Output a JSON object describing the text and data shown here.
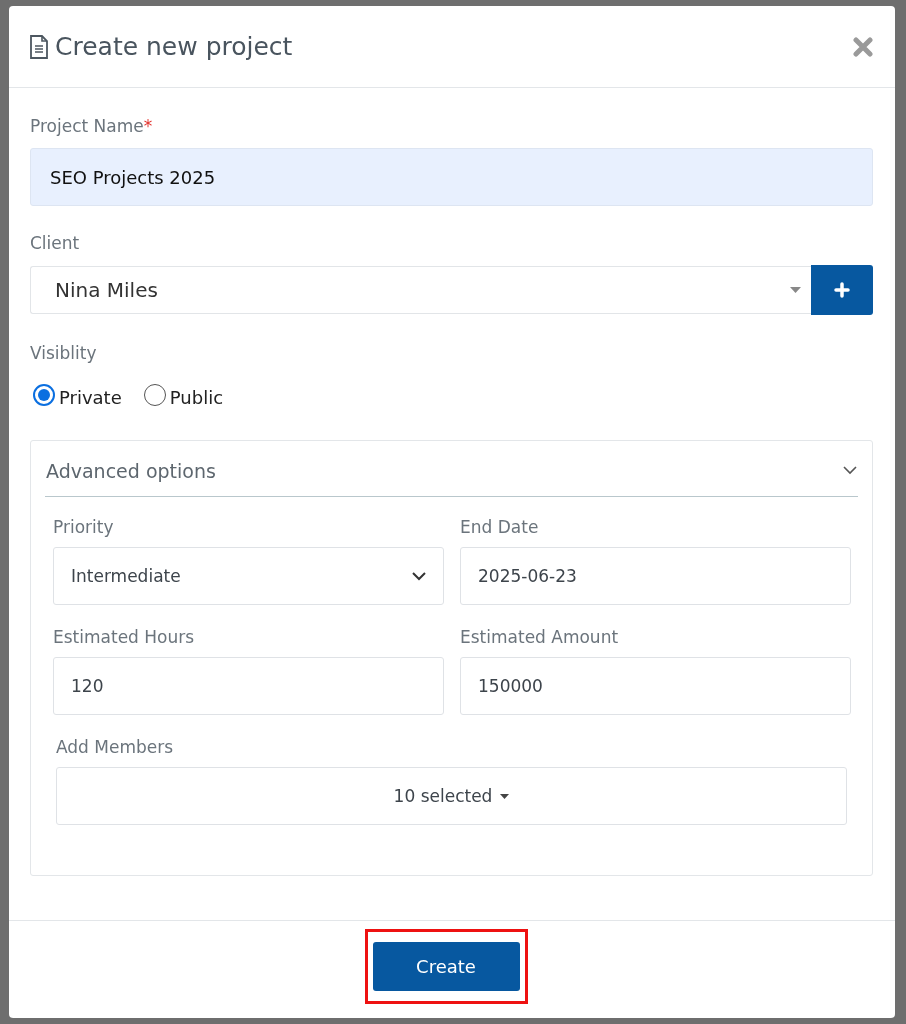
{
  "dialog": {
    "title": "Create new project"
  },
  "project_name": {
    "label": "Project Name",
    "required_mark": "*",
    "value": "SEO Projects 2025"
  },
  "client": {
    "label": "Client",
    "value": "Nina Miles"
  },
  "visibility": {
    "label": "Visiblity",
    "options": [
      {
        "label": "Private",
        "selected": true
      },
      {
        "label": "Public",
        "selected": false
      }
    ]
  },
  "advanced": {
    "title": "Advanced options",
    "expanded": true,
    "fields": [
      {
        "kind": "select",
        "label": "Priority",
        "value": "Intermediate"
      },
      {
        "kind": "input",
        "label": "End Date",
        "value": "2025-06-23"
      },
      {
        "kind": "input",
        "label": "Estimated Hours",
        "value": "120"
      },
      {
        "kind": "input",
        "label": "Estimated Amount",
        "value": "150000"
      },
      {
        "kind": "multiselect",
        "label": "Add Members",
        "value": "10 selected"
      }
    ]
  },
  "create_button": {
    "label": "Create",
    "highlighted": true
  }
}
